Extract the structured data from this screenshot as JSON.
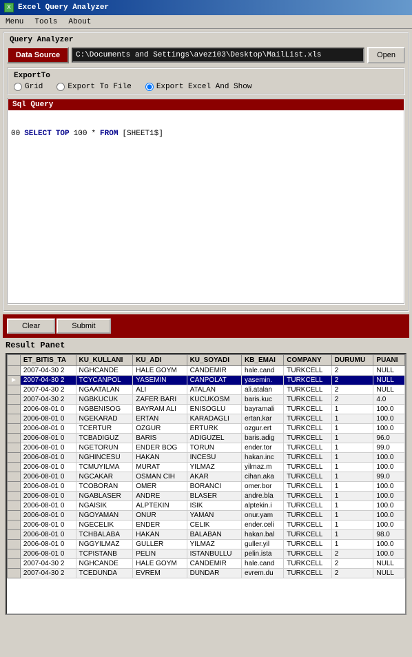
{
  "titleBar": {
    "icon": "X",
    "title": "Excel Query Analyzer"
  },
  "menuBar": {
    "items": [
      "Menu",
      "Tools",
      "About"
    ]
  },
  "queryAnalyzer": {
    "sectionLabel": "Query Analyzer",
    "dataSource": {
      "buttonLabel": "Data Source",
      "filePath": "C:\\Documents and Settings\\avez103\\Desktop\\MailList.xls",
      "openLabel": "Open"
    },
    "exportTo": {
      "sectionLabel": "ExportTo",
      "options": [
        "Grid",
        "Export To File",
        "Export Excel And Show"
      ],
      "selected": "Export Excel And Show"
    },
    "sqlQuery": {
      "sectionLabel": "Sql Query",
      "lines": [
        {
          "no": "00",
          "text": "SELECT TOP 100 * FROM [SHEET1$]"
        }
      ]
    }
  },
  "buttons": {
    "clear": "Clear",
    "submit": "Submit"
  },
  "resultPanel": {
    "label": "Result Panet",
    "columns": [
      "",
      "ET_BITIS_TA",
      "KU_KULLANI",
      "KU_ADI",
      "KU_SOYADI",
      "KB_EMAI",
      "COMPANY",
      "DURUMU",
      "PUANI"
    ],
    "rows": [
      {
        "selected": false,
        "indicator": "",
        "ET_BITIS_TA": "2007-04-30 2",
        "KU_KULLANI": "NGHCANDE",
        "KU_ADI": "HALE GOYM",
        "KU_SOYADI": "CANDEMIR",
        "KB_EMAI": "hale.cand",
        "COMPANY": "TURKCELL",
        "DURUMU": "2",
        "PUANI": "NULL"
      },
      {
        "selected": true,
        "indicator": "►",
        "ET_BITIS_TA": "2007-04-30 2",
        "KU_KULLANI": "TCYCANPOL",
        "KU_ADI": "YASEMIN",
        "KU_SOYADI": "CANPOLAT",
        "KB_EMAI": "yasemin.",
        "COMPANY": "TURKCELL",
        "DURUMU": "2",
        "PUANI": "NULL"
      },
      {
        "selected": false,
        "indicator": "",
        "ET_BITIS_TA": "2007-04-30 2",
        "KU_KULLANI": "NGAATALAN",
        "KU_ADI": "ALI",
        "KU_SOYADI": "ATALAN",
        "KB_EMAI": "ali.atalan",
        "COMPANY": "TURKCELL",
        "DURUMU": "2",
        "PUANI": "NULL"
      },
      {
        "selected": false,
        "indicator": "",
        "ET_BITIS_TA": "2007-04-30 2",
        "KU_KULLANI": "NGBKUCUK",
        "KU_ADI": "ZAFER BARI",
        "KU_SOYADI": "KUCUKOSM",
        "KB_EMAI": "baris.kuc",
        "COMPANY": "TURKCELL",
        "DURUMU": "2",
        "PUANI": "4.0"
      },
      {
        "selected": false,
        "indicator": "",
        "ET_BITIS_TA": "2006-08-01 0",
        "KU_KULLANI": "NGBENISOG",
        "KU_ADI": "BAYRAM ALI",
        "KU_SOYADI": "ENISOGLU",
        "KB_EMAI": "bayramali",
        "COMPANY": "TURKCELL",
        "DURUMU": "1",
        "PUANI": "100.0"
      },
      {
        "selected": false,
        "indicator": "",
        "ET_BITIS_TA": "2006-08-01 0",
        "KU_KULLANI": "NGEKARAD",
        "KU_ADI": "ERTAN",
        "KU_SOYADI": "KARADAGLI",
        "KB_EMAI": "ertan.kar",
        "COMPANY": "TURKCELL",
        "DURUMU": "1",
        "PUANI": "100.0"
      },
      {
        "selected": false,
        "indicator": "",
        "ET_BITIS_TA": "2006-08-01 0",
        "KU_KULLANI": "TCERTUR",
        "KU_ADI": "OZGUR",
        "KU_SOYADI": "ERTURK",
        "KB_EMAI": "ozgur.ert",
        "COMPANY": "TURKCELL",
        "DURUMU": "1",
        "PUANI": "100.0"
      },
      {
        "selected": false,
        "indicator": "",
        "ET_BITIS_TA": "2006-08-01 0",
        "KU_KULLANI": "TCBADIGUZ",
        "KU_ADI": "BARIS",
        "KU_SOYADI": "ADIGUZEL",
        "KB_EMAI": "baris.adig",
        "COMPANY": "TURKCELL",
        "DURUMU": "1",
        "PUANI": "96.0"
      },
      {
        "selected": false,
        "indicator": "",
        "ET_BITIS_TA": "2006-08-01 0",
        "KU_KULLANI": "NGETORUN",
        "KU_ADI": "ENDER BOG",
        "KU_SOYADI": "TORUN",
        "KB_EMAI": "ender.tor",
        "COMPANY": "TURKCELL",
        "DURUMU": "1",
        "PUANI": "99.0"
      },
      {
        "selected": false,
        "indicator": "",
        "ET_BITIS_TA": "2006-08-01 0",
        "KU_KULLANI": "NGHINCESU",
        "KU_ADI": "HAKAN",
        "KU_SOYADI": "INCESU",
        "KB_EMAI": "hakan.inc",
        "COMPANY": "TURKCELL",
        "DURUMU": "1",
        "PUANI": "100.0"
      },
      {
        "selected": false,
        "indicator": "",
        "ET_BITIS_TA": "2006-08-01 0",
        "KU_KULLANI": "TCMUYILMA",
        "KU_ADI": "MURAT",
        "KU_SOYADI": "YILMAZ",
        "KB_EMAI": "yilmaz.m",
        "COMPANY": "TURKCELL",
        "DURUMU": "1",
        "PUANI": "100.0"
      },
      {
        "selected": false,
        "indicator": "",
        "ET_BITIS_TA": "2006-08-01 0",
        "KU_KULLANI": "NGCAKAR",
        "KU_ADI": "OSMAN CIH",
        "KU_SOYADI": "AKAR",
        "KB_EMAI": "cihan.aka",
        "COMPANY": "TURKCELL",
        "DURUMU": "1",
        "PUANI": "99.0"
      },
      {
        "selected": false,
        "indicator": "",
        "ET_BITIS_TA": "2006-08-01 0",
        "KU_KULLANI": "TCOBORAN",
        "KU_ADI": "OMER",
        "KU_SOYADI": "BORANCI",
        "KB_EMAI": "omer.bor",
        "COMPANY": "TURKCELL",
        "DURUMU": "1",
        "PUANI": "100.0"
      },
      {
        "selected": false,
        "indicator": "",
        "ET_BITIS_TA": "2006-08-01 0",
        "KU_KULLANI": "NGABLASER",
        "KU_ADI": "ANDRE",
        "KU_SOYADI": "BLASER",
        "KB_EMAI": "andre.bla",
        "COMPANY": "TURKCELL",
        "DURUMU": "1",
        "PUANI": "100.0"
      },
      {
        "selected": false,
        "indicator": "",
        "ET_BITIS_TA": "2006-08-01 0",
        "KU_KULLANI": "NGAISIK",
        "KU_ADI": "ALPTEKIN",
        "KU_SOYADI": "ISIK",
        "KB_EMAI": "alptekin.i",
        "COMPANY": "TURKCELL",
        "DURUMU": "1",
        "PUANI": "100.0"
      },
      {
        "selected": false,
        "indicator": "",
        "ET_BITIS_TA": "2006-08-01 0",
        "KU_KULLANI": "NGOYAMAN",
        "KU_ADI": "ONUR",
        "KU_SOYADI": "YAMAN",
        "KB_EMAI": "onur.yam",
        "COMPANY": "TURKCELL",
        "DURUMU": "1",
        "PUANI": "100.0"
      },
      {
        "selected": false,
        "indicator": "",
        "ET_BITIS_TA": "2006-08-01 0",
        "KU_KULLANI": "NGECELIK",
        "KU_ADI": "ENDER",
        "KU_SOYADI": "CELIK",
        "KB_EMAI": "ender.celi",
        "COMPANY": "TURKCELL",
        "DURUMU": "1",
        "PUANI": "100.0"
      },
      {
        "selected": false,
        "indicator": "",
        "ET_BITIS_TA": "2006-08-01 0",
        "KU_KULLANI": "TCHBALABA",
        "KU_ADI": "HAKAN",
        "KU_SOYADI": "BALABAN",
        "KB_EMAI": "hakan.bal",
        "COMPANY": "TURKCELL",
        "DURUMU": "1",
        "PUANI": "98.0"
      },
      {
        "selected": false,
        "indicator": "",
        "ET_BITIS_TA": "2006-08-01 0",
        "KU_KULLANI": "NGGYILMAZ",
        "KU_ADI": "GULLER",
        "KU_SOYADI": "YILMAZ",
        "KB_EMAI": "guller.yil",
        "COMPANY": "TURKCELL",
        "DURUMU": "1",
        "PUANI": "100.0"
      },
      {
        "selected": false,
        "indicator": "",
        "ET_BITIS_TA": "2006-08-01 0",
        "KU_KULLANI": "TCPISTANB",
        "KU_ADI": "PELIN",
        "KU_SOYADI": "ISTANBULLU",
        "KB_EMAI": "pelin.ista",
        "COMPANY": "TURKCELL",
        "DURUMU": "2",
        "PUANI": "100.0"
      },
      {
        "selected": false,
        "indicator": "",
        "ET_BITIS_TA": "2007-04-30 2",
        "KU_KULLANI": "NGHCANDE",
        "KU_ADI": "HALE GOYM",
        "KU_SOYADI": "CANDEMIR",
        "KB_EMAI": "hale.cand",
        "COMPANY": "TURKCELL",
        "DURUMU": "2",
        "PUANI": "NULL"
      },
      {
        "selected": false,
        "indicator": "",
        "ET_BITIS_TA": "2007-04-30 2",
        "KU_KULLANI": "TCEDUNDA",
        "KU_ADI": "EVREM",
        "KU_SOYADI": "DUNDAR",
        "KB_EMAI": "evrem.du",
        "COMPANY": "TURKCELL",
        "DURUMU": "2",
        "PUANI": "NULL"
      }
    ]
  }
}
